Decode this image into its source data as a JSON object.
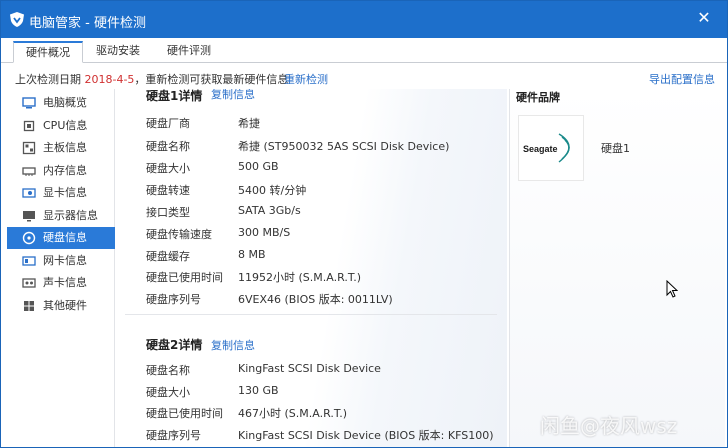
{
  "window": {
    "title": "电脑管家 - 硬件检测",
    "icon": "shield-logo-icon"
  },
  "tabs": [
    {
      "label": "硬件概况",
      "active": true
    },
    {
      "label": "驱动安装",
      "active": false
    },
    {
      "label": "硬件评测",
      "active": false
    }
  ],
  "infobar": {
    "prefix": "上次检测日期",
    "date": "2018-4-5",
    "suffix": "，重新检测可获取最新硬件信息",
    "recheck_label": "重新检测",
    "export_label": "导出配置信息"
  },
  "sidebar": {
    "items": [
      {
        "label": "电脑概览",
        "icon": "computer-icon",
        "active": false
      },
      {
        "label": "CPU信息",
        "icon": "cpu-icon",
        "active": false
      },
      {
        "label": "主板信息",
        "icon": "motherboard-icon",
        "active": false
      },
      {
        "label": "内存信息",
        "icon": "memory-icon",
        "active": false
      },
      {
        "label": "显卡信息",
        "icon": "graphics-card-icon",
        "active": false
      },
      {
        "label": "显示器信息",
        "icon": "monitor-icon",
        "active": false
      },
      {
        "label": "硬盘信息",
        "icon": "hard-disk-icon",
        "active": true
      },
      {
        "label": "网卡信息",
        "icon": "network-card-icon",
        "active": false
      },
      {
        "label": "声卡信息",
        "icon": "sound-card-icon",
        "active": false
      },
      {
        "label": "其他硬件",
        "icon": "other-hardware-icon",
        "active": false
      }
    ]
  },
  "disk1": {
    "title": "硬盘1详情",
    "copy_label": "复制信息",
    "rows": [
      {
        "label": "硬盘厂商",
        "value": "希捷"
      },
      {
        "label": "硬盘名称",
        "value": "希捷 (ST950032 5AS SCSI Disk Device)"
      },
      {
        "label": "硬盘大小",
        "value": "500 GB"
      },
      {
        "label": "硬盘转速",
        "value": "5400 转/分钟"
      },
      {
        "label": "接口类型",
        "value": "SATA 3Gb/s"
      },
      {
        "label": "硬盘传输速度",
        "value": "300 MB/S"
      },
      {
        "label": "硬盘缓存",
        "value": "8 MB"
      },
      {
        "label": "硬盘已使用时间",
        "value": "11952小时 (S.M.A.R.T.)"
      },
      {
        "label": "硬盘序列号",
        "value": "6VEX46 (BIOS 版本: 0011LV)"
      }
    ]
  },
  "disk2": {
    "title": "硬盘2详情",
    "copy_label": "复制信息",
    "rows": [
      {
        "label": "硬盘名称",
        "value": "KingFast  SCSI Disk Device"
      },
      {
        "label": "硬盘大小",
        "value": "130 GB"
      },
      {
        "label": "硬盘已使用时间",
        "value": "467小时 (S.M.A.R.T.)"
      },
      {
        "label": "硬盘序列号",
        "value": "KingFast  SCSI Disk Device (BIOS 版本: KFS100)"
      }
    ]
  },
  "brand": {
    "title": "硬件品牌",
    "logo_text": "Seagate",
    "disk_label": "硬盘1"
  },
  "watermark": "闲鱼@夜风wsz",
  "colors": {
    "accent": "#1d6fcb",
    "selected": "#2a7ad8",
    "link": "#2a6fc9",
    "date": "#d03030",
    "seagate": "#1a8a8a"
  }
}
